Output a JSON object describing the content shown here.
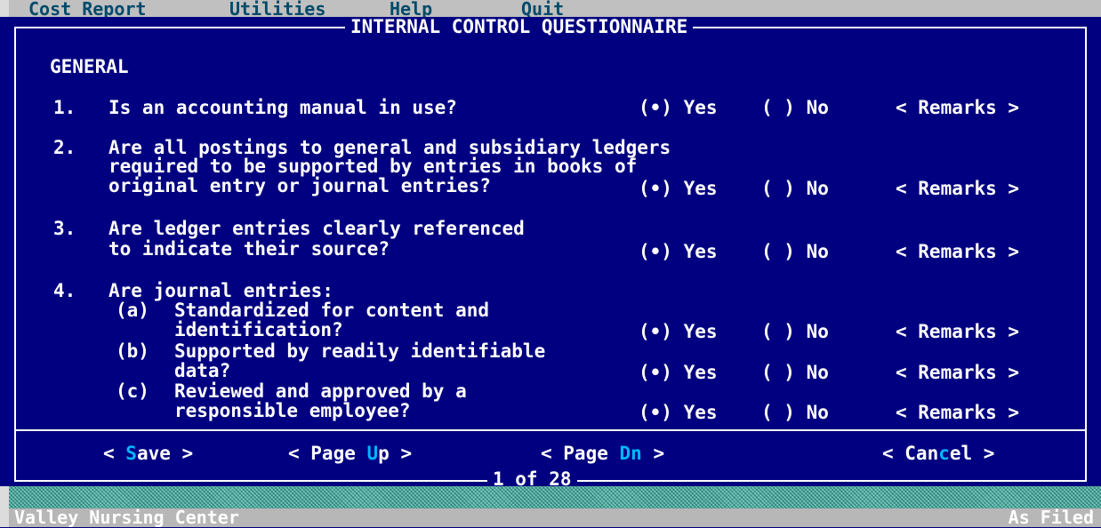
{
  "menu": {
    "items": [
      "Cost Report",
      "Utilities",
      "Help",
      "Quit"
    ]
  },
  "dialog": {
    "title": "INTERNAL CONTROL QUESTIONNAIRE",
    "section": "GENERAL",
    "questions": [
      {
        "number": "1.",
        "lines": [
          "Is an accounting manual in use?"
        ],
        "yes": "(•) Yes",
        "no": "( ) No",
        "remarks": "< Remarks >",
        "selected": "Yes"
      },
      {
        "number": "2.",
        "lines": [
          "Are all postings to general and subsidiary ledgers",
          "required to be supported by entries in books of",
          "original entry or journal entries?"
        ],
        "yes": "(•) Yes",
        "no": "( ) No",
        "remarks": "< Remarks >",
        "selected": "Yes"
      },
      {
        "number": "3.",
        "lines": [
          "Are ledger entries clearly referenced",
          "to indicate their source?"
        ],
        "yes": "(•) Yes",
        "no": "( ) No",
        "remarks": "< Remarks >",
        "selected": "Yes"
      },
      {
        "number": "4.",
        "lines": [
          "Are journal entries:"
        ],
        "subitems": [
          {
            "label": "(a)",
            "lines": [
              "Standardized for content and",
              "identification?"
            ],
            "yes": "(•) Yes",
            "no": "( ) No",
            "remarks": "< Remarks >",
            "selected": "Yes"
          },
          {
            "label": "(b)",
            "lines": [
              "Supported by readily identifiable",
              "data?"
            ],
            "yes": "(•) Yes",
            "no": "( ) No",
            "remarks": "< Remarks >",
            "selected": "Yes"
          },
          {
            "label": "(c)",
            "lines": [
              "Reviewed and approved by a",
              "responsible employee?"
            ],
            "yes": "(•) Yes",
            "no": "( ) No",
            "remarks": "< Remarks >",
            "selected": "Yes"
          }
        ]
      }
    ],
    "buttons": {
      "save": {
        "pre": "< ",
        "hot": "S",
        "post": "ave >"
      },
      "page_up": {
        "pre": "< Page ",
        "hot": "U",
        "post": "p >"
      },
      "page_dn": {
        "pre": "< Page ",
        "hot": "Dn",
        "post": " >"
      },
      "cancel": {
        "pre": "< Can",
        "hot": "c",
        "post": "el >"
      }
    },
    "page_indicator": "1 of 28"
  },
  "status": {
    "left": "Valley Nursing Center",
    "right": "As Filed"
  },
  "colors": {
    "background": "#000080",
    "text": "#ffffff",
    "hotkey": "#00b5ff",
    "menu_text": "#004a6a",
    "menu_bg": "#c0c0c0",
    "status_bg": "#b7b7b7"
  }
}
